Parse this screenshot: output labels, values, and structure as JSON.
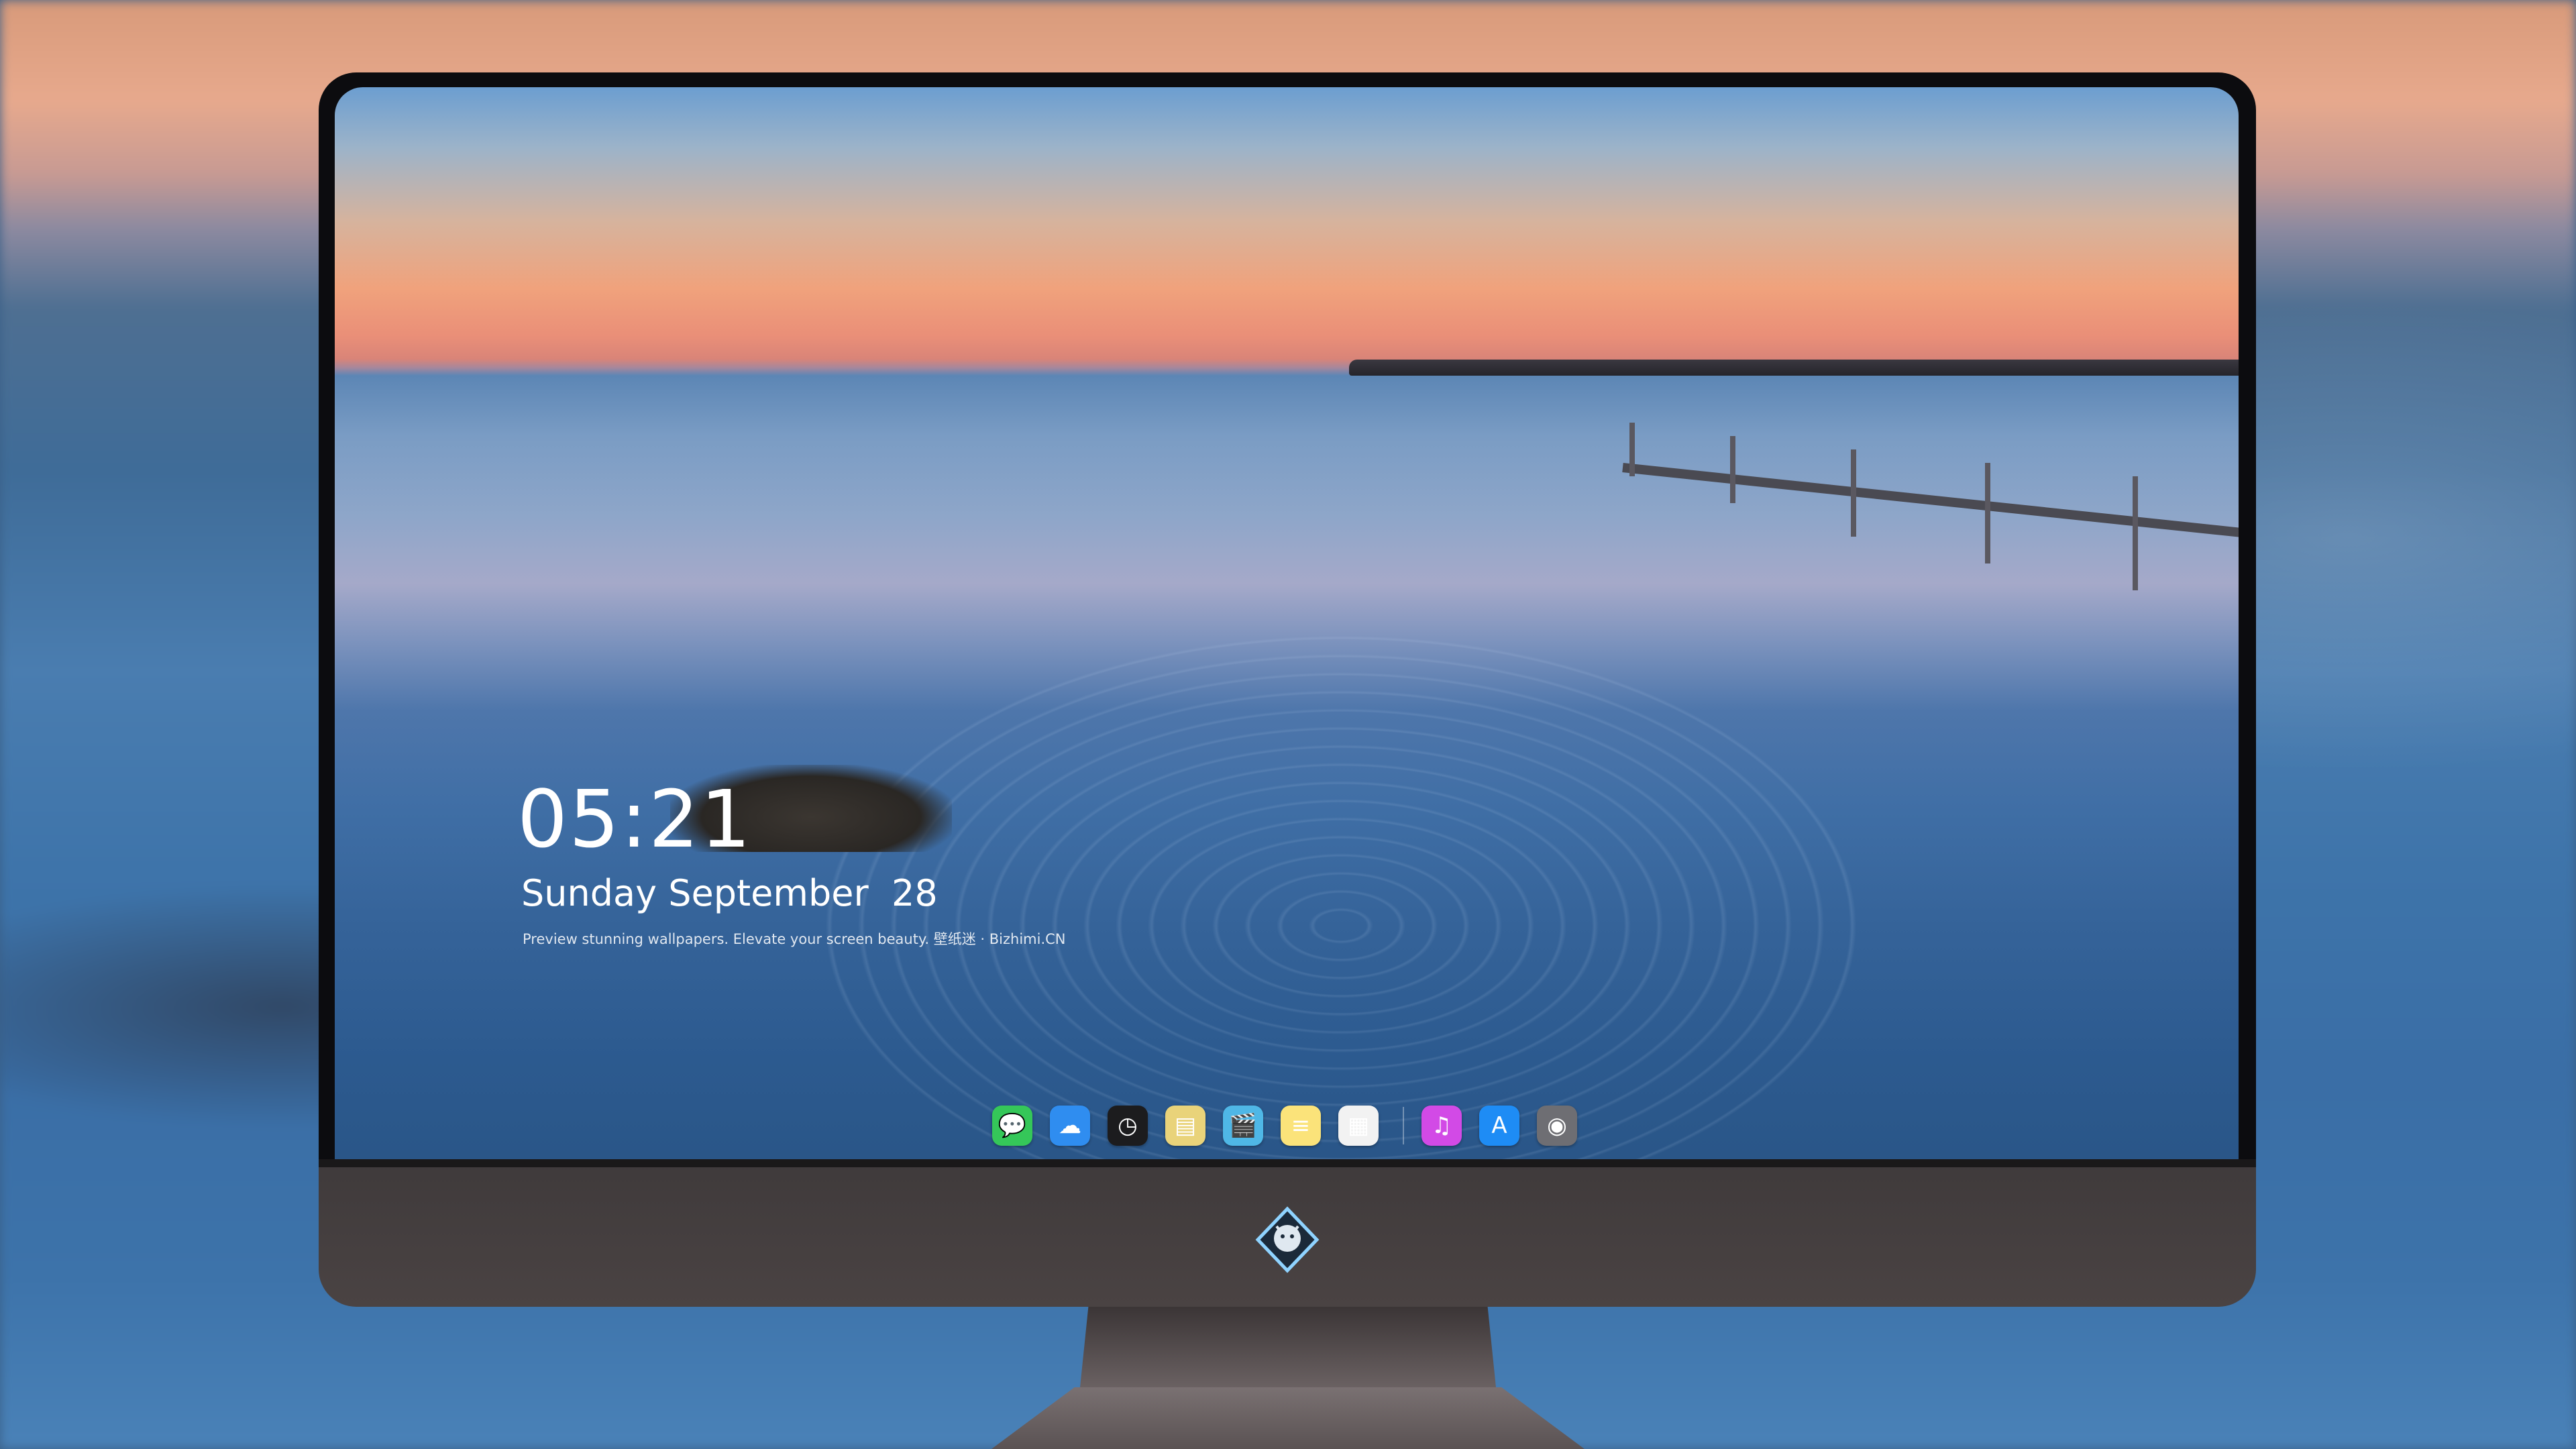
{
  "lock_screen": {
    "time": "05:21",
    "date": "Sunday September  28",
    "tagline": "Preview stunning wallpapers. Elevate your screen beauty. 壁纸迷 · Bizhimi.CN"
  },
  "dock": {
    "items": [
      {
        "name": "messages-icon",
        "glyph": "💬",
        "color": "#35c759"
      },
      {
        "name": "weather-icon",
        "glyph": "☁",
        "color": "#2f8df0"
      },
      {
        "name": "clock-icon",
        "glyph": "◷",
        "color": "#1c1c1e"
      },
      {
        "name": "preview-icon",
        "glyph": "▤",
        "color": "#e9d37a"
      },
      {
        "name": "videos-icon",
        "glyph": "🎬",
        "color": "#4fb7e6"
      },
      {
        "name": "notes-icon",
        "glyph": "≡",
        "color": "#fbe37a"
      },
      {
        "name": "photos-icon",
        "glyph": "▦",
        "color": "#f2f2f2"
      },
      {
        "name": "music-icon",
        "glyph": "♫",
        "color": "#d24ae6"
      },
      {
        "name": "app-store-icon",
        "glyph": "A",
        "color": "#1e8cf5"
      },
      {
        "name": "camera-icon",
        "glyph": "◉",
        "color": "#6e6e73"
      }
    ],
    "separator_after_index": 6
  },
  "chin": {
    "logo_icon": "dragon-logo-icon"
  }
}
